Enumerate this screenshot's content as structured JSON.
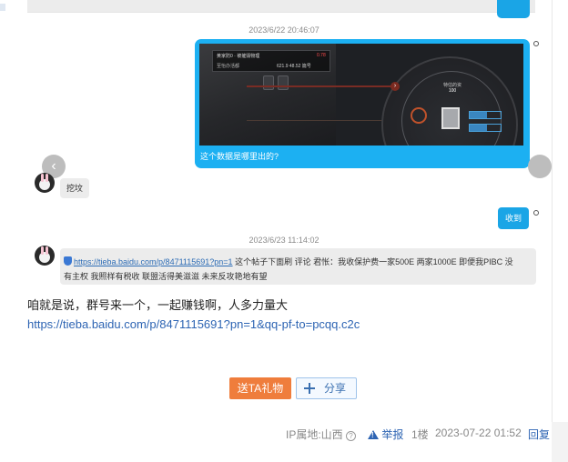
{
  "chat": {
    "timestamp_1": "2023/6/22 20:46:07",
    "image_caption": "这个数据是哪里出的?",
    "game_shot": {
      "title": "黄家防0 · 被摧毁物理",
      "sub": "至怡办活都",
      "red_value": "0.78",
      "stat": "621.9  48.52  篇号",
      "center_label": "特估的资",
      "center_value": "100",
      "hud_1": "10%",
      "hud_2": "10%"
    },
    "reply_1": "挖坟",
    "reply_2": "收到",
    "timestamp_2": "2023/6/23 11:14:02",
    "quote_link": "https://tieba.baidu.com/p/8471115691?pn=1",
    "quote_text_1": " 这个帖子下面刷 评论 君怅：我收保护费一家500E 两家1000E  即便我PIBC 没",
    "quote_text_2": "有主权 我照样有税收 联盟活得美滋滋 未来反攻艳地有望"
  },
  "post": {
    "body_text": "咱就是说，群号来一个，一起赚钱啊，人多力量大",
    "body_link": "https://tieba.baidu.com/p/8471115691?pn=1&qq-pf-to=pcqq.c2c"
  },
  "actions": {
    "gift_label": "送TA礼物",
    "share_label": "分享"
  },
  "footer": {
    "ip_location": "IP属地:山西",
    "help_glyph": "?",
    "report_label": "举报",
    "floor": "1楼",
    "datetime": "2023-07-22 01:52",
    "reply_label": "回复"
  },
  "colors": {
    "chat_blue": "#1aa5e6",
    "gift_orange": "#ef7d3c",
    "link_blue": "#2d64b3"
  }
}
